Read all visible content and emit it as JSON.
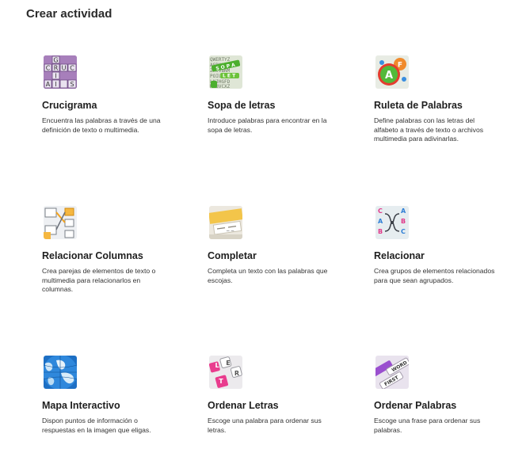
{
  "page": {
    "title": "Crear actividad"
  },
  "activities": [
    {
      "title": "Crucigrama",
      "description": "Encuentra las palabras a través de una definición de texto o multimedia.",
      "icon": "crossword-icon"
    },
    {
      "title": "Sopa de letras",
      "description": "Introduce palabras para encontrar en la sopa de letras.",
      "icon": "word-search-icon"
    },
    {
      "title": "Ruleta de Palabras",
      "description": "Define palabras con las letras del alfabeto a través de texto o archivos multimedia para adivinarlas.",
      "icon": "word-wheel-icon"
    },
    {
      "title": "Relacionar Columnas",
      "description": "Crea parejas de elementos de texto o multimedia para relacionarlos en columnas.",
      "icon": "match-columns-icon"
    },
    {
      "title": "Completar",
      "description": "Completa un texto con las palabras que escojas.",
      "icon": "fill-blanks-icon"
    },
    {
      "title": "Relacionar",
      "description": "Crea grupos de elementos relacionados para que sean agrupados.",
      "icon": "group-relate-icon"
    },
    {
      "title": "Mapa Interactivo",
      "description": "Dispon puntos de información o respuestas en la imagen que eligas.",
      "icon": "interactive-map-icon"
    },
    {
      "title": "Ordenar Letras",
      "description": "Escoge una palabra para ordenar sus letras.",
      "icon": "order-letters-icon"
    },
    {
      "title": "Ordenar Palabras",
      "description": "Escoge una frase para ordenar sus palabras.",
      "icon": "order-words-icon"
    }
  ]
}
